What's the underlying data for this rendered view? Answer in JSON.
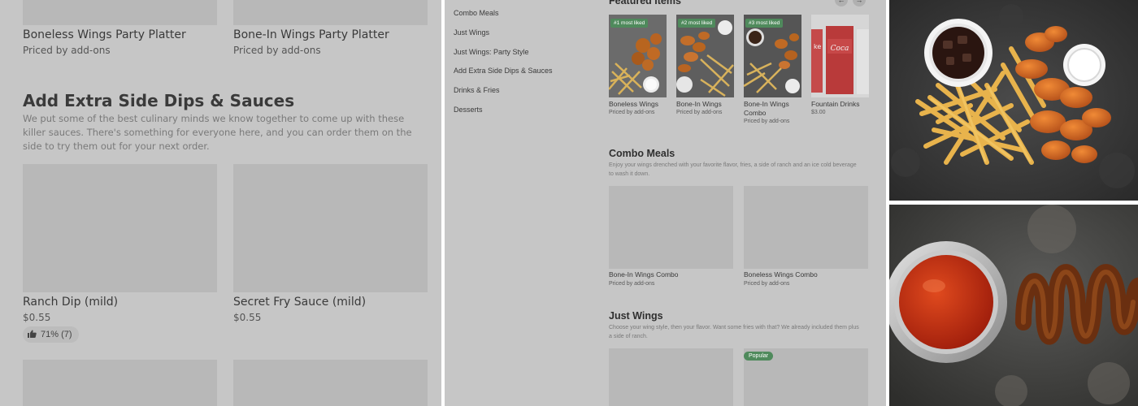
{
  "left": {
    "top_items": [
      {
        "name": "Boneless Wings Party Platter",
        "price": "Priced by add-ons"
      },
      {
        "name": "Bone-In Wings Party Platter",
        "price": "Priced by add-ons"
      }
    ],
    "section_title": "Add Extra Side Dips & Sauces",
    "section_desc": "We put some of the best culinary minds we know together to come up with these killer sauces. There's something for everyone here, and you can order them on the side to try them out for your next order.",
    "items": [
      {
        "name": "Ranch Dip (mild)",
        "price": "$0.55"
      },
      {
        "name": "Secret Fry Sauce (mild)",
        "price": "$0.55"
      }
    ],
    "rating": "71% (7)"
  },
  "middle": {
    "nav": [
      "Combo Meals",
      "Just Wings",
      "Just Wings: Party Style",
      "Add Extra Side Dips & Sauces",
      "Drinks & Fries",
      "Desserts"
    ],
    "featured_title": "Featured Items",
    "featured": [
      {
        "badge": "#1 most liked",
        "name": "Boneless Wings",
        "price": "Priced by add-ons"
      },
      {
        "badge": "#2 most liked",
        "name": "Bone-In Wings",
        "price": "Priced by add-ons"
      },
      {
        "badge": "#3 most liked",
        "name": "Bone-In Wings Combo",
        "price": "Priced by add-ons"
      },
      {
        "badge": "",
        "name": "Fountain Drinks",
        "price": "$3.00"
      }
    ],
    "combo_title": "Combo Meals",
    "combo_desc": "Enjoy your wings drenched with your favorite flavor, fries, a side of ranch and an ice cold beverage to wash it down.",
    "combo_items": [
      {
        "name": "Bone-In Wings Combo",
        "price": "Priced by add-ons"
      },
      {
        "name": "Boneless Wings Combo",
        "price": "Priced by add-ons"
      }
    ],
    "wings_title": "Just Wings",
    "wings_desc": "Choose your wing style, then your flavor. Want some fries with that? We already included them plus a side of ranch.",
    "popular_badge": "Popular"
  },
  "colors": {
    "overlay_gray": "#c6c6c6",
    "placeholder": "#b8b8b8",
    "badge_green": "#4f8a5c"
  }
}
